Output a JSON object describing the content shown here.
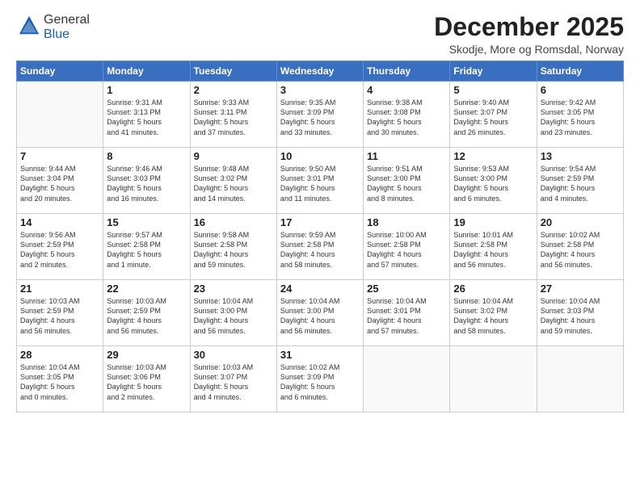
{
  "header": {
    "logo_general": "General",
    "logo_blue": "Blue",
    "month": "December 2025",
    "location": "Skodje, More og Romsdal, Norway"
  },
  "weekdays": [
    "Sunday",
    "Monday",
    "Tuesday",
    "Wednesday",
    "Thursday",
    "Friday",
    "Saturday"
  ],
  "weeks": [
    [
      {
        "day": "",
        "info": ""
      },
      {
        "day": "1",
        "info": "Sunrise: 9:31 AM\nSunset: 3:13 PM\nDaylight: 5 hours\nand 41 minutes."
      },
      {
        "day": "2",
        "info": "Sunrise: 9:33 AM\nSunset: 3:11 PM\nDaylight: 5 hours\nand 37 minutes."
      },
      {
        "day": "3",
        "info": "Sunrise: 9:35 AM\nSunset: 3:09 PM\nDaylight: 5 hours\nand 33 minutes."
      },
      {
        "day": "4",
        "info": "Sunrise: 9:38 AM\nSunset: 3:08 PM\nDaylight: 5 hours\nand 30 minutes."
      },
      {
        "day": "5",
        "info": "Sunrise: 9:40 AM\nSunset: 3:07 PM\nDaylight: 5 hours\nand 26 minutes."
      },
      {
        "day": "6",
        "info": "Sunrise: 9:42 AM\nSunset: 3:05 PM\nDaylight: 5 hours\nand 23 minutes."
      }
    ],
    [
      {
        "day": "7",
        "info": "Sunrise: 9:44 AM\nSunset: 3:04 PM\nDaylight: 5 hours\nand 20 minutes."
      },
      {
        "day": "8",
        "info": "Sunrise: 9:46 AM\nSunset: 3:03 PM\nDaylight: 5 hours\nand 16 minutes."
      },
      {
        "day": "9",
        "info": "Sunrise: 9:48 AM\nSunset: 3:02 PM\nDaylight: 5 hours\nand 14 minutes."
      },
      {
        "day": "10",
        "info": "Sunrise: 9:50 AM\nSunset: 3:01 PM\nDaylight: 5 hours\nand 11 minutes."
      },
      {
        "day": "11",
        "info": "Sunrise: 9:51 AM\nSunset: 3:00 PM\nDaylight: 5 hours\nand 8 minutes."
      },
      {
        "day": "12",
        "info": "Sunrise: 9:53 AM\nSunset: 3:00 PM\nDaylight: 5 hours\nand 6 minutes."
      },
      {
        "day": "13",
        "info": "Sunrise: 9:54 AM\nSunset: 2:59 PM\nDaylight: 5 hours\nand 4 minutes."
      }
    ],
    [
      {
        "day": "14",
        "info": "Sunrise: 9:56 AM\nSunset: 2:59 PM\nDaylight: 5 hours\nand 2 minutes."
      },
      {
        "day": "15",
        "info": "Sunrise: 9:57 AM\nSunset: 2:58 PM\nDaylight: 5 hours\nand 1 minute."
      },
      {
        "day": "16",
        "info": "Sunrise: 9:58 AM\nSunset: 2:58 PM\nDaylight: 4 hours\nand 59 minutes."
      },
      {
        "day": "17",
        "info": "Sunrise: 9:59 AM\nSunset: 2:58 PM\nDaylight: 4 hours\nand 58 minutes."
      },
      {
        "day": "18",
        "info": "Sunrise: 10:00 AM\nSunset: 2:58 PM\nDaylight: 4 hours\nand 57 minutes."
      },
      {
        "day": "19",
        "info": "Sunrise: 10:01 AM\nSunset: 2:58 PM\nDaylight: 4 hours\nand 56 minutes."
      },
      {
        "day": "20",
        "info": "Sunrise: 10:02 AM\nSunset: 2:58 PM\nDaylight: 4 hours\nand 56 minutes."
      }
    ],
    [
      {
        "day": "21",
        "info": "Sunrise: 10:03 AM\nSunset: 2:59 PM\nDaylight: 4 hours\nand 56 minutes."
      },
      {
        "day": "22",
        "info": "Sunrise: 10:03 AM\nSunset: 2:59 PM\nDaylight: 4 hours\nand 56 minutes."
      },
      {
        "day": "23",
        "info": "Sunrise: 10:04 AM\nSunset: 3:00 PM\nDaylight: 4 hours\nand 56 minutes."
      },
      {
        "day": "24",
        "info": "Sunrise: 10:04 AM\nSunset: 3:00 PM\nDaylight: 4 hours\nand 56 minutes."
      },
      {
        "day": "25",
        "info": "Sunrise: 10:04 AM\nSunset: 3:01 PM\nDaylight: 4 hours\nand 57 minutes."
      },
      {
        "day": "26",
        "info": "Sunrise: 10:04 AM\nSunset: 3:02 PM\nDaylight: 4 hours\nand 58 minutes."
      },
      {
        "day": "27",
        "info": "Sunrise: 10:04 AM\nSunset: 3:03 PM\nDaylight: 4 hours\nand 59 minutes."
      }
    ],
    [
      {
        "day": "28",
        "info": "Sunrise: 10:04 AM\nSunset: 3:05 PM\nDaylight: 5 hours\nand 0 minutes."
      },
      {
        "day": "29",
        "info": "Sunrise: 10:03 AM\nSunset: 3:06 PM\nDaylight: 5 hours\nand 2 minutes."
      },
      {
        "day": "30",
        "info": "Sunrise: 10:03 AM\nSunset: 3:07 PM\nDaylight: 5 hours\nand 4 minutes."
      },
      {
        "day": "31",
        "info": "Sunrise: 10:02 AM\nSunset: 3:09 PM\nDaylight: 5 hours\nand 6 minutes."
      },
      {
        "day": "",
        "info": ""
      },
      {
        "day": "",
        "info": ""
      },
      {
        "day": "",
        "info": ""
      }
    ]
  ]
}
